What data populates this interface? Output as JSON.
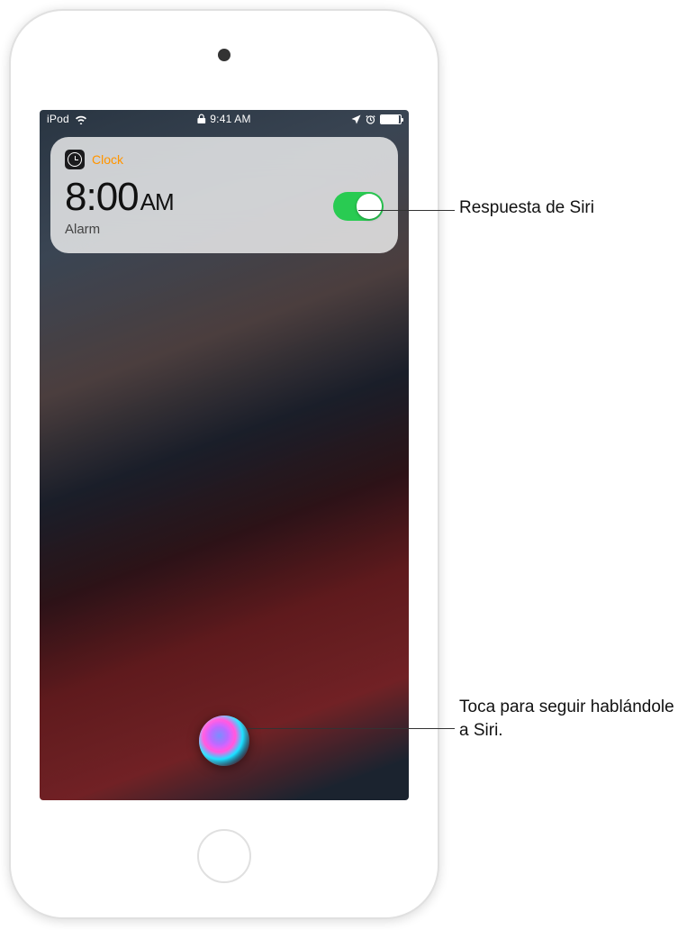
{
  "status_bar": {
    "carrier": "iPod",
    "time": "9:41 AM"
  },
  "clock_card": {
    "app_name": "Clock",
    "time": "8:00",
    "ampm": "AM",
    "label": "Alarm",
    "toggle_on": true
  },
  "callouts": {
    "siri_response": "Respuesta de Siri",
    "siri_continue": "Toca para seguir hablándole a Siri."
  }
}
